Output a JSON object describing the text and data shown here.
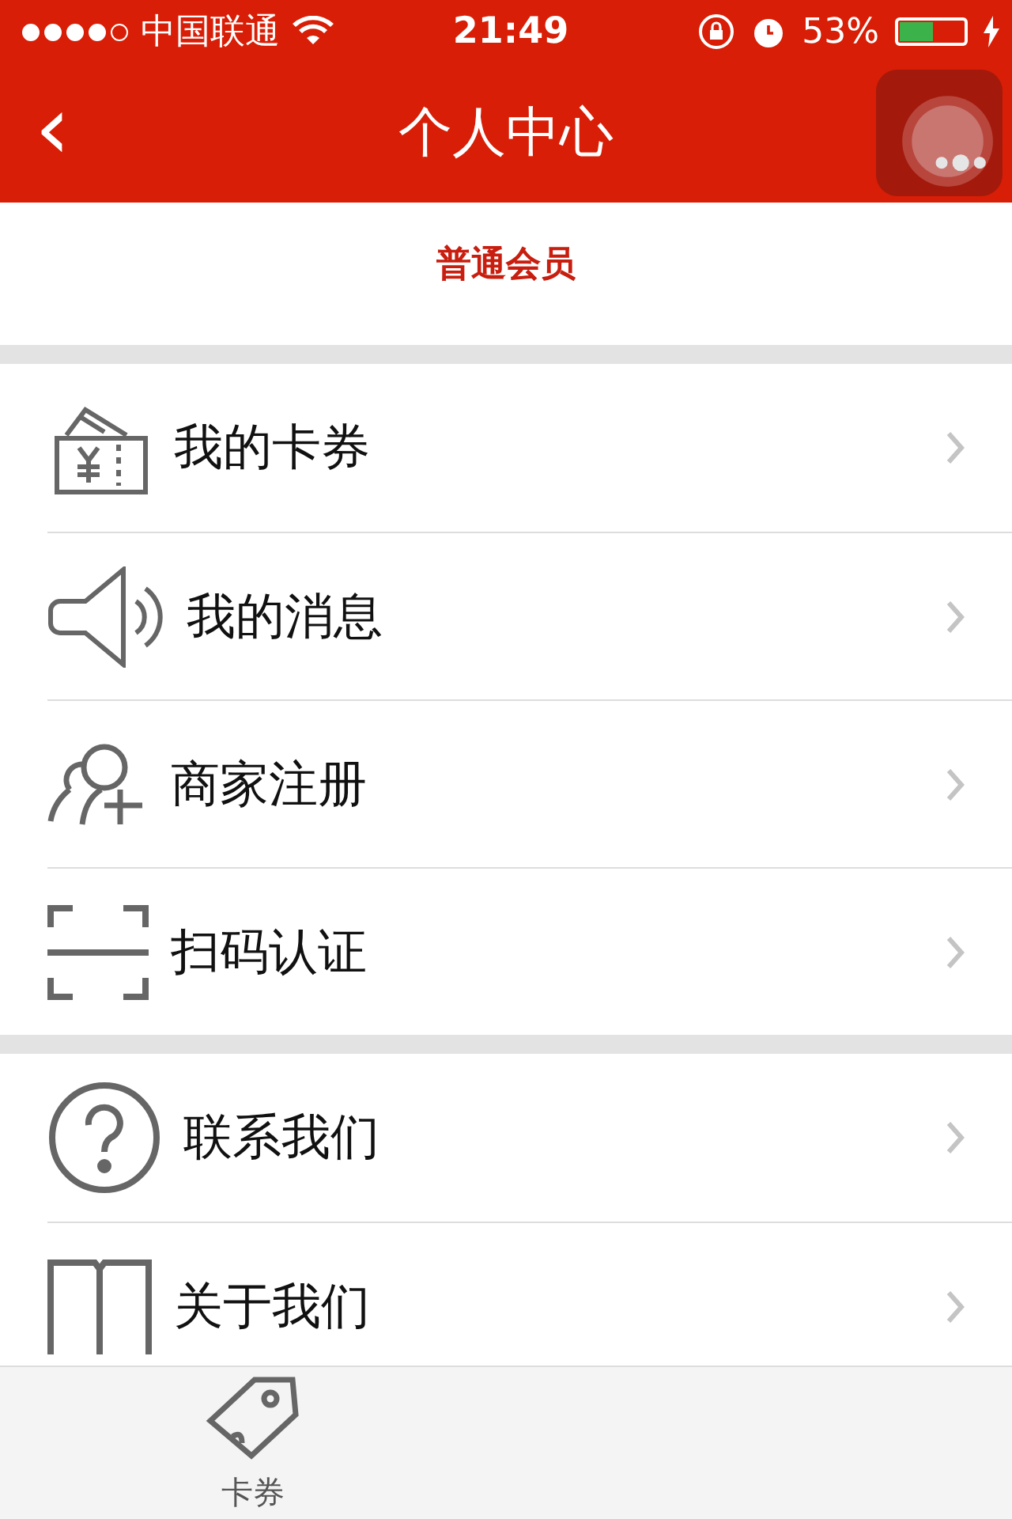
{
  "status_bar": {
    "signal_dots": [
      {
        "filled": true
      },
      {
        "filled": true
      },
      {
        "filled": true
      },
      {
        "filled": true
      },
      {
        "filled": false
      }
    ],
    "carrier": "中国联通",
    "time": "21:49",
    "battery_text": "53%",
    "battery": {
      "level": 0.53
    }
  },
  "nav": {
    "back": "‹",
    "title": "个人中心"
  },
  "profile": {
    "member_level": "普通会员"
  },
  "groups": [
    {
      "items": [
        {
          "kind": "ticket",
          "label": "我的卡券"
        },
        {
          "kind": "speaker",
          "label": "我的消息"
        },
        {
          "kind": "user-add",
          "label": "商家注册"
        },
        {
          "kind": "scan",
          "label": "扫码认证"
        }
      ]
    },
    {
      "items": [
        {
          "kind": "help",
          "label": "联系我们"
        },
        {
          "kind": "book",
          "label": "关于我们"
        }
      ]
    }
  ],
  "tab_bar": [
    {
      "kind": "tag",
      "label": "卡券"
    }
  ]
}
